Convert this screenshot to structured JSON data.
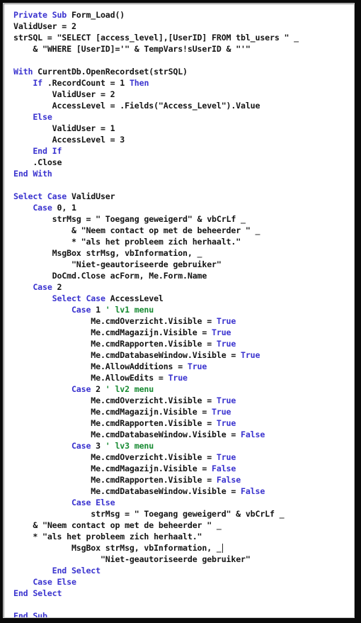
{
  "window": {
    "title": "Form_Load VBA code listing",
    "background_color": "#ffffff",
    "bezel_color": "#0a0a0a",
    "gutter_color": "#c9c9c9"
  },
  "editor": {
    "language": "VBA",
    "colors": {
      "keyword": "#3a33cf",
      "comment": "#168a31",
      "plain": "#141414",
      "background": "#ffffff"
    },
    "caret_line_index": 45,
    "line_count": 53
  },
  "code": {
    "lines": [
      {
        "i": 0,
        "indent": 0,
        "tokens": [
          {
            "t": "kw",
            "s": "Private Sub "
          },
          {
            "t": "pln",
            "s": "Form_Load()"
          }
        ]
      },
      {
        "i": 1,
        "indent": 0,
        "tokens": [
          {
            "t": "pln",
            "s": "ValidUser = 2"
          }
        ]
      },
      {
        "i": 2,
        "indent": 0,
        "tokens": [
          {
            "t": "pln",
            "s": "strSQL = \"SELECT [access_level],[UserID] FROM tbl_users \" "
          },
          {
            "t": "cont",
            "s": "_"
          }
        ]
      },
      {
        "i": 3,
        "indent": 4,
        "tokens": [
          {
            "t": "pln",
            "s": "& \"WHERE [UserID]='\" & TempVars!sUserID & \"'\""
          }
        ]
      },
      {
        "i": 4,
        "indent": 0,
        "tokens": []
      },
      {
        "i": 5,
        "indent": 0,
        "tokens": [
          {
            "t": "kw",
            "s": "With "
          },
          {
            "t": "pln",
            "s": "CurrentDb.OpenRecordset(strSQL)"
          }
        ]
      },
      {
        "i": 6,
        "indent": 4,
        "tokens": [
          {
            "t": "kw",
            "s": "If "
          },
          {
            "t": "pln",
            "s": ".RecordCount = 1 "
          },
          {
            "t": "kw",
            "s": "Then"
          }
        ]
      },
      {
        "i": 7,
        "indent": 8,
        "tokens": [
          {
            "t": "pln",
            "s": "ValidUser = 2"
          }
        ]
      },
      {
        "i": 8,
        "indent": 8,
        "tokens": [
          {
            "t": "pln",
            "s": "AccessLevel = .Fields(\"Access_Level\").Value"
          }
        ]
      },
      {
        "i": 9,
        "indent": 4,
        "tokens": [
          {
            "t": "kw",
            "s": "Else"
          }
        ]
      },
      {
        "i": 10,
        "indent": 8,
        "tokens": [
          {
            "t": "pln",
            "s": "ValidUser = 1"
          }
        ]
      },
      {
        "i": 11,
        "indent": 8,
        "tokens": [
          {
            "t": "pln",
            "s": "AccessLevel = 3"
          }
        ]
      },
      {
        "i": 12,
        "indent": 4,
        "tokens": [
          {
            "t": "kw",
            "s": "End If"
          }
        ]
      },
      {
        "i": 13,
        "indent": 4,
        "tokens": [
          {
            "t": "pln",
            "s": ".Close"
          }
        ]
      },
      {
        "i": 14,
        "indent": 0,
        "tokens": [
          {
            "t": "kw",
            "s": "End With"
          }
        ]
      },
      {
        "i": 15,
        "indent": 0,
        "tokens": []
      },
      {
        "i": 16,
        "indent": 0,
        "tokens": [
          {
            "t": "kw",
            "s": "Select Case "
          },
          {
            "t": "pln",
            "s": "ValidUser"
          }
        ]
      },
      {
        "i": 17,
        "indent": 4,
        "tokens": [
          {
            "t": "kw",
            "s": "Case "
          },
          {
            "t": "pln",
            "s": "0, 1"
          }
        ]
      },
      {
        "i": 18,
        "indent": 8,
        "tokens": [
          {
            "t": "pln",
            "s": "strMsg = \" Toegang geweigerd\" & vbCrLf "
          },
          {
            "t": "cont",
            "s": "_"
          }
        ]
      },
      {
        "i": 19,
        "indent": 12,
        "tokens": [
          {
            "t": "pln",
            "s": "& \"Neem contact op met de beheerder \" "
          },
          {
            "t": "cont",
            "s": "_"
          }
        ]
      },
      {
        "i": 20,
        "indent": 12,
        "tokens": [
          {
            "t": "pln",
            "s": "* \"als het probleem zich herhaalt.\""
          }
        ]
      },
      {
        "i": 21,
        "indent": 8,
        "tokens": [
          {
            "t": "pln",
            "s": "MsgBox strMsg, vbInformation, "
          },
          {
            "t": "cont",
            "s": "_"
          }
        ]
      },
      {
        "i": 22,
        "indent": 12,
        "tokens": [
          {
            "t": "pln",
            "s": "\"Niet-geautoriseerde gebruiker\""
          }
        ]
      },
      {
        "i": 23,
        "indent": 8,
        "tokens": [
          {
            "t": "pln",
            "s": "DoCmd.Close acForm, Me.Form.Name"
          }
        ]
      },
      {
        "i": 24,
        "indent": 4,
        "tokens": [
          {
            "t": "kw",
            "s": "Case "
          },
          {
            "t": "pln",
            "s": "2"
          }
        ]
      },
      {
        "i": 25,
        "indent": 8,
        "tokens": [
          {
            "t": "kw",
            "s": "Select Case "
          },
          {
            "t": "pln",
            "s": "AccessLevel"
          }
        ]
      },
      {
        "i": 26,
        "indent": 12,
        "tokens": [
          {
            "t": "kw",
            "s": "Case "
          },
          {
            "t": "pln",
            "s": "1 "
          },
          {
            "t": "cmt",
            "s": "' lv1 menu"
          }
        ]
      },
      {
        "i": 27,
        "indent": 16,
        "tokens": [
          {
            "t": "pln",
            "s": "Me.cmdOverzicht.Visible = "
          },
          {
            "t": "kw",
            "s": "True"
          }
        ]
      },
      {
        "i": 28,
        "indent": 16,
        "tokens": [
          {
            "t": "pln",
            "s": "Me.cmdMagazijn.Visible = "
          },
          {
            "t": "kw",
            "s": "True"
          }
        ]
      },
      {
        "i": 29,
        "indent": 16,
        "tokens": [
          {
            "t": "pln",
            "s": "Me.cmdRapporten.Visible = "
          },
          {
            "t": "kw",
            "s": "True"
          }
        ]
      },
      {
        "i": 30,
        "indent": 16,
        "tokens": [
          {
            "t": "pln",
            "s": "Me.cmdDatabaseWindow.Visible = "
          },
          {
            "t": "kw",
            "s": "True"
          }
        ]
      },
      {
        "i": 31,
        "indent": 16,
        "tokens": [
          {
            "t": "pln",
            "s": "Me.AllowAdditions = "
          },
          {
            "t": "kw",
            "s": "True"
          }
        ]
      },
      {
        "i": 32,
        "indent": 16,
        "tokens": [
          {
            "t": "pln",
            "s": "Me.AllowEdits = "
          },
          {
            "t": "kw",
            "s": "True"
          }
        ]
      },
      {
        "i": 33,
        "indent": 12,
        "tokens": [
          {
            "t": "kw",
            "s": "Case "
          },
          {
            "t": "pln",
            "s": "2 "
          },
          {
            "t": "cmt",
            "s": "' lv2 menu"
          }
        ]
      },
      {
        "i": 34,
        "indent": 16,
        "tokens": [
          {
            "t": "pln",
            "s": "Me.cmdOverzicht.Visible = "
          },
          {
            "t": "kw",
            "s": "True"
          }
        ]
      },
      {
        "i": 35,
        "indent": 16,
        "tokens": [
          {
            "t": "pln",
            "s": "Me.cmdMagazijn.Visible = "
          },
          {
            "t": "kw",
            "s": "True"
          }
        ]
      },
      {
        "i": 36,
        "indent": 16,
        "tokens": [
          {
            "t": "pln",
            "s": "Me.cmdRapporten.Visible = "
          },
          {
            "t": "kw",
            "s": "True"
          }
        ]
      },
      {
        "i": 37,
        "indent": 16,
        "tokens": [
          {
            "t": "pln",
            "s": "Me.cmdDatabaseWindow.Visible = "
          },
          {
            "t": "kw",
            "s": "False"
          }
        ]
      },
      {
        "i": 38,
        "indent": 12,
        "tokens": [
          {
            "t": "kw",
            "s": "Case "
          },
          {
            "t": "pln",
            "s": "3 "
          },
          {
            "t": "cmt",
            "s": "' lv3 menu"
          }
        ]
      },
      {
        "i": 39,
        "indent": 16,
        "tokens": [
          {
            "t": "pln",
            "s": "Me.cmdOverzicht.Visible = "
          },
          {
            "t": "kw",
            "s": "True"
          }
        ]
      },
      {
        "i": 40,
        "indent": 16,
        "tokens": [
          {
            "t": "pln",
            "s": "Me.cmdMagazijn.Visible = "
          },
          {
            "t": "kw",
            "s": "False"
          }
        ]
      },
      {
        "i": 41,
        "indent": 16,
        "tokens": [
          {
            "t": "pln",
            "s": "Me.cmdRapporten.Visible = "
          },
          {
            "t": "kw",
            "s": "False"
          }
        ]
      },
      {
        "i": 42,
        "indent": 16,
        "tokens": [
          {
            "t": "pln",
            "s": "Me.cmdDatabaseWindow.Visible = "
          },
          {
            "t": "kw",
            "s": "False"
          }
        ]
      },
      {
        "i": 43,
        "indent": 12,
        "tokens": [
          {
            "t": "kw",
            "s": "Case Else"
          }
        ]
      },
      {
        "i": 44,
        "indent": 16,
        "tokens": [
          {
            "t": "pln",
            "s": "strMsg = \" Toegang geweigerd\" & vbCrLf "
          },
          {
            "t": "cont",
            "s": "_"
          }
        ]
      },
      {
        "i": 45,
        "indent": 4,
        "tokens": [
          {
            "t": "pln",
            "s": "& \"Neem contact op met de beheerder \" "
          },
          {
            "t": "cont",
            "s": "_"
          }
        ]
      },
      {
        "i": 46,
        "indent": 4,
        "tokens": [
          {
            "t": "pln",
            "s": "* \"als het probleem zich herhaalt.\""
          }
        ]
      },
      {
        "i": 47,
        "indent": 12,
        "tokens": [
          {
            "t": "pln",
            "s": "MsgBox strMsg, vbInformation, "
          },
          {
            "t": "cont",
            "s": "_",
            "caret": true
          }
        ]
      },
      {
        "i": 48,
        "indent": 18,
        "tokens": [
          {
            "t": "pln",
            "s": "\"Niet-geautoriseerde gebruiker\""
          }
        ]
      },
      {
        "i": 49,
        "indent": 8,
        "tokens": [
          {
            "t": "kw",
            "s": "End Select"
          }
        ]
      },
      {
        "i": 50,
        "indent": 4,
        "tokens": [
          {
            "t": "kw",
            "s": "Case Else"
          }
        ]
      },
      {
        "i": 51,
        "indent": 0,
        "tokens": [
          {
            "t": "kw",
            "s": "End Select"
          }
        ]
      },
      {
        "i": 52,
        "indent": 0,
        "tokens": []
      },
      {
        "i": 53,
        "indent": 0,
        "tokens": [
          {
            "t": "kw",
            "s": "End Sub"
          }
        ]
      }
    ]
  }
}
